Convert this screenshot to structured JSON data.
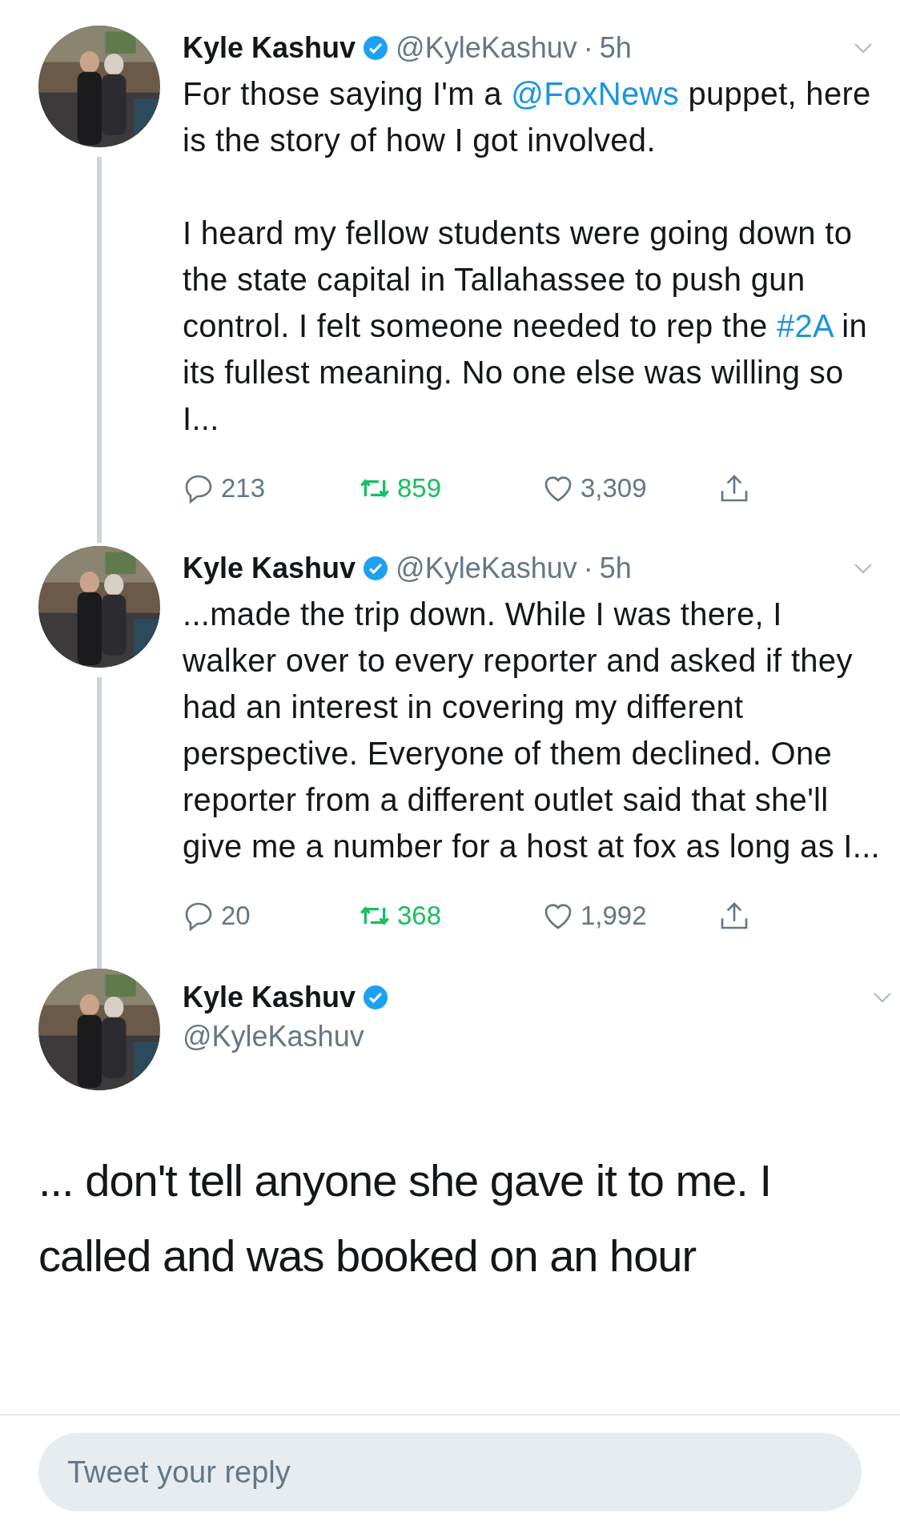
{
  "tweets": [
    {
      "kind": "thread",
      "name": "Kyle Kashuv",
      "verified": true,
      "handle": "@KyleKashuv",
      "separator": "·",
      "time": "5h",
      "paragraphs": [
        [
          {
            "text": "For those saying I'm a "
          },
          {
            "text": "@FoxNews",
            "link": true
          },
          {
            "text": " puppet, here is the story of how I got involved."
          }
        ],
        [
          {
            "text": "I heard my fellow students were going down to the state capital in Tallahassee to push gun control. I felt someone needed to rep the "
          },
          {
            "text": "#2A",
            "link": true
          },
          {
            "text": " in its fullest meaning.  No one else was willing so I..."
          }
        ]
      ],
      "replies": "213",
      "retweets": "859",
      "likes": "3,309",
      "retweeted": true
    },
    {
      "kind": "thread",
      "name": "Kyle Kashuv",
      "verified": true,
      "handle": "@KyleKashuv",
      "separator": "·",
      "time": "5h",
      "paragraphs": [
        [
          {
            "text": "...made the trip down. While I was there, I walker over to every reporter and asked if they had an interest in covering my different perspective. Everyone of them declined. One reporter from a different outlet said that she'll give me a number for a host at fox as long as I..."
          }
        ]
      ],
      "replies": "20",
      "retweets": "368",
      "likes": "1,992",
      "retweeted": true
    },
    {
      "kind": "expanded",
      "name": "Kyle Kashuv",
      "verified": true,
      "handle": "@KyleKashuv",
      "paragraphs": [
        [
          {
            "text": "... don't tell anyone she gave it to me. I called and was booked on an hour"
          }
        ]
      ]
    }
  ],
  "reply_bar": {
    "placeholder": "Tweet your reply"
  }
}
